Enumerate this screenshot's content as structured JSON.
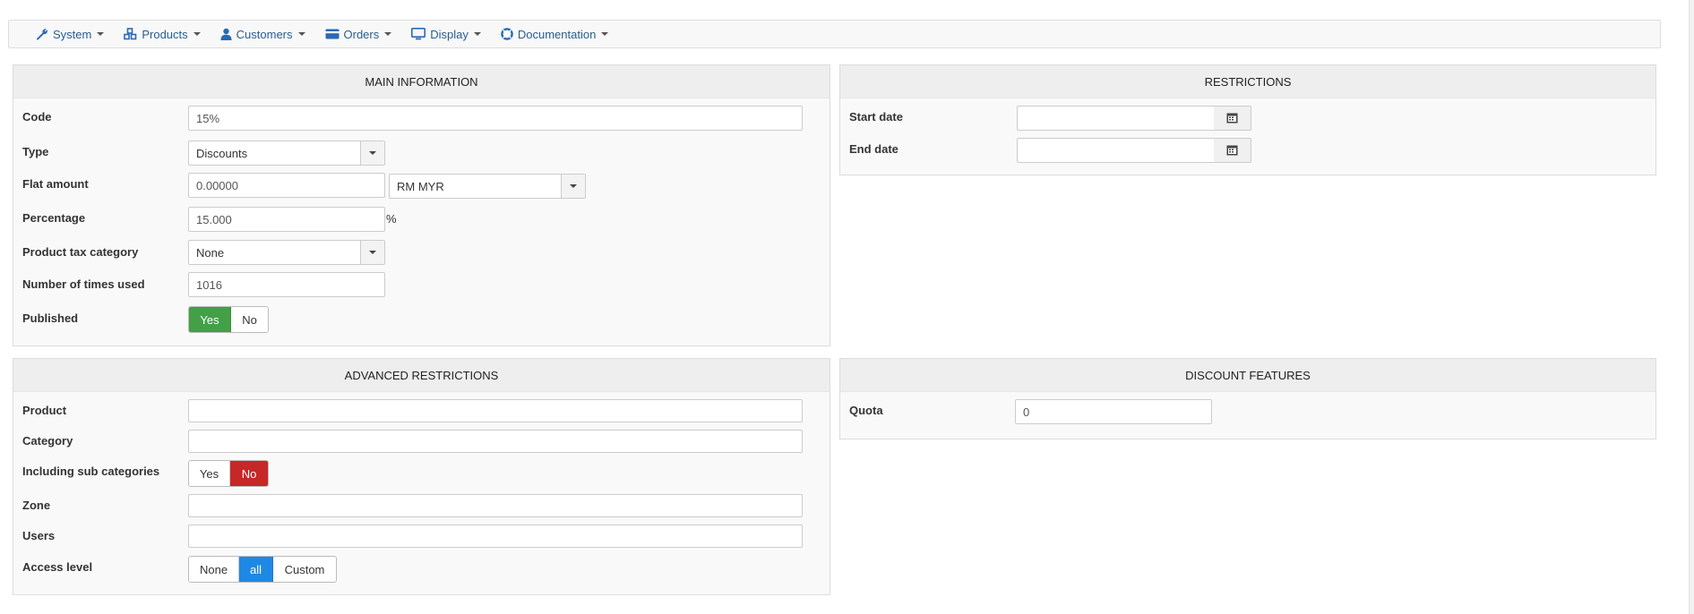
{
  "menu": {
    "items": [
      {
        "label": "System",
        "icon": "wrench-icon"
      },
      {
        "label": "Products",
        "icon": "cubes-icon"
      },
      {
        "label": "Customers",
        "icon": "user-icon"
      },
      {
        "label": "Orders",
        "icon": "credit-card-icon"
      },
      {
        "label": "Display",
        "icon": "monitor-icon"
      },
      {
        "label": "Documentation",
        "icon": "life-ring-icon"
      }
    ]
  },
  "main_info": {
    "title": "MAIN INFORMATION",
    "code_label": "Code",
    "code_value": "15%",
    "type_label": "Type",
    "type_value": "Discounts",
    "flat_label": "Flat amount",
    "flat_value": "0.00000",
    "currency_value": "RM MYR",
    "pct_label": "Percentage",
    "pct_value": "15.000",
    "pct_unit": "%",
    "tax_label": "Product tax category",
    "tax_value": "None",
    "used_label": "Number of times used",
    "used_value": "1016",
    "published_label": "Published",
    "yes_label": "Yes",
    "no_label": "No",
    "published_selected": "Yes"
  },
  "restrictions": {
    "title": "RESTRICTIONS",
    "start_label": "Start date",
    "start_value": "",
    "end_label": "End date",
    "end_value": ""
  },
  "advanced": {
    "title": "ADVANCED RESTRICTIONS",
    "product_label": "Product",
    "product_value": "",
    "category_label": "Category",
    "category_value": "",
    "subcat_label": "Including sub categories",
    "yes_label": "Yes",
    "no_label": "No",
    "subcat_selected": "No",
    "zone_label": "Zone",
    "zone_value": "",
    "users_label": "Users",
    "users_value": "",
    "access_label": "Access level",
    "access_options": [
      "None",
      "all",
      "Custom"
    ],
    "access_selected": "all"
  },
  "discount_features": {
    "title": "DISCOUNT FEATURES",
    "quota_label": "Quota",
    "quota_value": "0"
  },
  "colors": {
    "menu_link": "#2a5d8f",
    "yes_active": "#43a047",
    "no_active": "#c62828",
    "all_active": "#1e88e5"
  }
}
